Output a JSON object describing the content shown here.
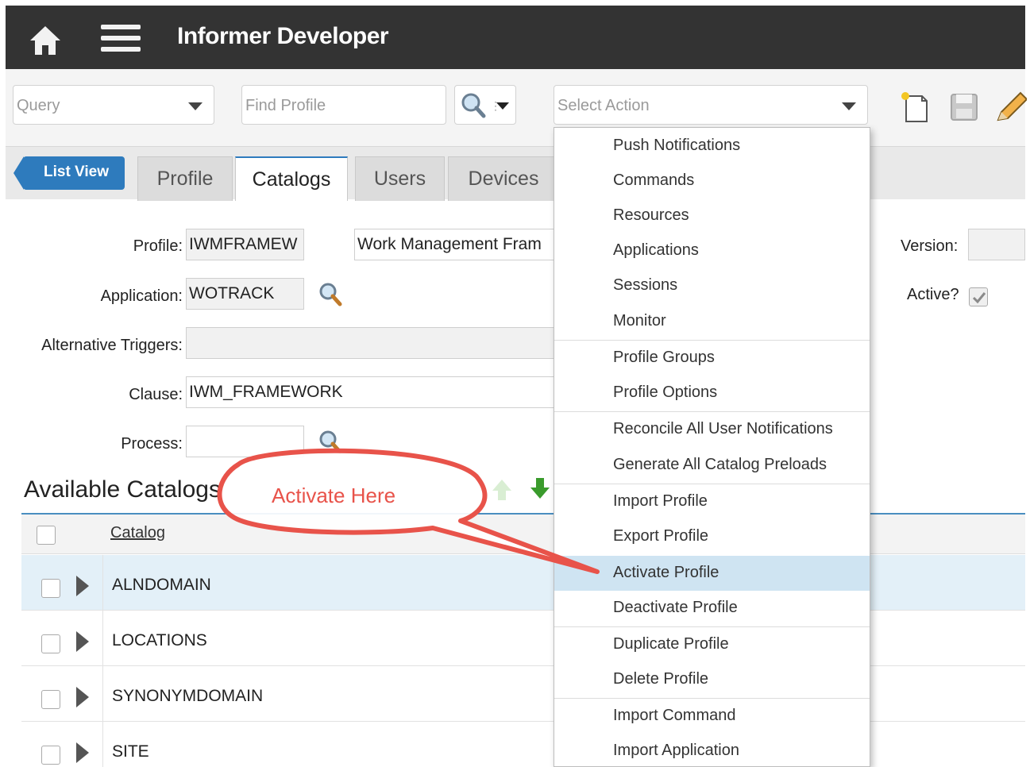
{
  "header": {
    "title": "Informer Developer",
    "home_icon": "home-icon",
    "menu_icon": "hamburger-menu-icon"
  },
  "toolbar": {
    "query_value": "Query",
    "find_placeholder": "Find Profile",
    "action_placeholder": "Select Action"
  },
  "tabs": {
    "list_view": "List View",
    "items": [
      {
        "label": "Profile",
        "active": false
      },
      {
        "label": "Catalogs",
        "active": true
      },
      {
        "label": "Users",
        "active": false
      },
      {
        "label": "Devices",
        "active": false
      }
    ]
  },
  "form": {
    "profile_label": "Profile:",
    "profile_code": "IWMFRAMEW",
    "profile_desc": "Work Management Fram",
    "application_label": "Application:",
    "application_value": "WOTRACK",
    "alt_triggers_label": "Alternative Triggers:",
    "clause_label": "Clause:",
    "clause_value": "IWM_FRAMEWORK",
    "process_label": "Process:",
    "version_label": "Version:",
    "active_label": "Active?"
  },
  "catalogs": {
    "section_title": "Available Catalogs",
    "column_header": "Catalog",
    "rows": [
      "ALNDOMAIN",
      "LOCATIONS",
      "SYNONYMDOMAIN",
      "SITE"
    ]
  },
  "action_menu": {
    "items": [
      "Push Notifications",
      "Commands",
      "Resources",
      "Applications",
      "Sessions",
      "Monitor",
      "Profile Groups",
      "Profile Options",
      "Reconcile All User Notifications",
      "Generate All Catalog Preloads",
      "Import Profile",
      "Export Profile",
      "Activate Profile",
      "Deactivate Profile",
      "Duplicate Profile",
      "Delete Profile",
      "Import Command",
      "Import Application"
    ],
    "highlighted": "Activate Profile"
  },
  "annotation": {
    "text": "Activate Here",
    "color": "#e8534a"
  },
  "colors": {
    "header_bg": "#333333",
    "accent": "#2e7bbd",
    "highlight": "#cfe4f2"
  }
}
